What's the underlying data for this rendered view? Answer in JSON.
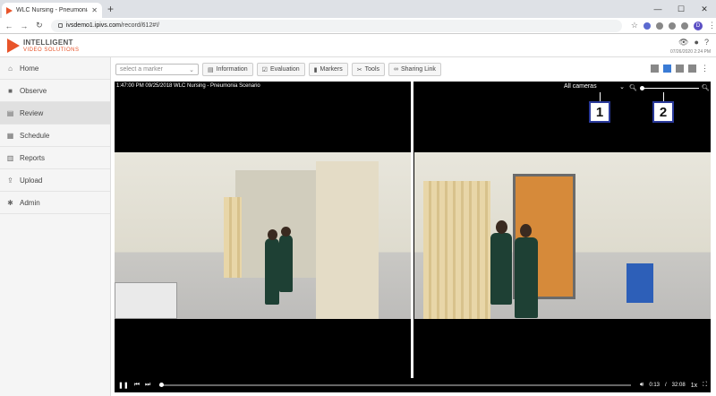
{
  "browser": {
    "tab_title": "WLC Nursing - Pneumonia S",
    "url_host": "ivsdemo1.ipivs.com",
    "url_path": "/record/612#!/",
    "profile_initial": "D"
  },
  "header": {
    "logo_line1": "INTELLIGENT",
    "logo_line2": "VIDEO SOLUTIONS",
    "date": "07/26/2020 2:24 PM"
  },
  "sidebar": {
    "items": [
      {
        "label": "Home",
        "icon": "home-icon",
        "glyph": "⌂"
      },
      {
        "label": "Observe",
        "icon": "video-camera-icon",
        "glyph": "■"
      },
      {
        "label": "Review",
        "icon": "film-icon",
        "glyph": "▤"
      },
      {
        "label": "Schedule",
        "icon": "calendar-icon",
        "glyph": "▦"
      },
      {
        "label": "Reports",
        "icon": "bar-chart-icon",
        "glyph": "▥"
      },
      {
        "label": "Upload",
        "icon": "upload-icon",
        "glyph": "⇪"
      },
      {
        "label": "Admin",
        "icon": "gear-icon",
        "glyph": "✱"
      }
    ]
  },
  "toolbar": {
    "marker_placeholder": "select a marker",
    "information": "Information",
    "evaluation": "Evaluation",
    "markers": "Markers",
    "tools": "Tools",
    "sharing_link": "Sharing Link"
  },
  "video": {
    "timestamp_title": "1:47:00 PM 09/25/2018 WLC Nursing - Pneumonia Scenario",
    "camera_select": "All cameras",
    "callout_1": "1",
    "callout_2": "2",
    "current_time": "0:13",
    "separator": "/",
    "total_time": "32:08",
    "speed": "1x"
  },
  "colors": {
    "accent": "#3a7bd5",
    "brand": "#e8542a",
    "callout_border": "#2a3a9b"
  }
}
